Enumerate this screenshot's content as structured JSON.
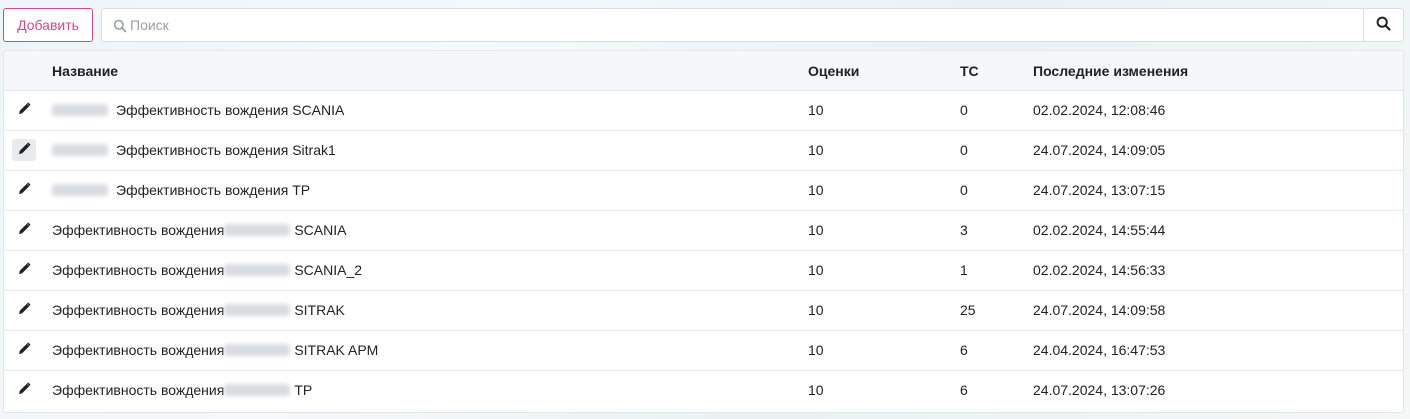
{
  "toolbar": {
    "add_label": "Добавить",
    "search_placeholder": "Поиск",
    "search_value": ""
  },
  "table": {
    "headers": {
      "name": "Название",
      "scores": "Оценки",
      "vehicles": "ТС",
      "last_modified": "Последние изменения"
    },
    "rows": [
      {
        "name": "Эффективность вождения SCANIA",
        "scores": "10",
        "vehicles": "0",
        "last_modified": "02.02.2024, 12:08:46"
      },
      {
        "name": "Эффективность вождения Sitrak1",
        "scores": "10",
        "vehicles": "0",
        "last_modified": "24.07.2024, 14:09:05"
      },
      {
        "name": "Эффективность вождения ТР",
        "scores": "10",
        "vehicles": "0",
        "last_modified": "24.07.2024, 13:07:15"
      },
      {
        "name_prefix": "Эффективность вождения",
        "name_suffix": "SCANIA",
        "scores": "10",
        "vehicles": "3",
        "last_modified": "02.02.2024, 14:55:44"
      },
      {
        "name_prefix": "Эффективность вождения",
        "name_suffix": "SCANIA_2",
        "scores": "10",
        "vehicles": "1",
        "last_modified": "02.02.2024, 14:56:33"
      },
      {
        "name_prefix": "Эффективность вождения",
        "name_suffix": "SITRAK",
        "scores": "10",
        "vehicles": "25",
        "last_modified": "24.07.2024, 14:09:58"
      },
      {
        "name_prefix": "Эффективность вождения",
        "name_suffix": "SITRAK APM",
        "scores": "10",
        "vehicles": "6",
        "last_modified": "24.04.2024, 16:47:53"
      },
      {
        "name_prefix": "Эффективность вождения",
        "name_suffix": "ТР",
        "scores": "10",
        "vehicles": "6",
        "last_modified": "24.07.2024, 13:07:26"
      }
    ]
  },
  "colors": {
    "accent": "#d04a8c",
    "header_bg": "#f6f7f9",
    "border": "#e3e6ea"
  }
}
